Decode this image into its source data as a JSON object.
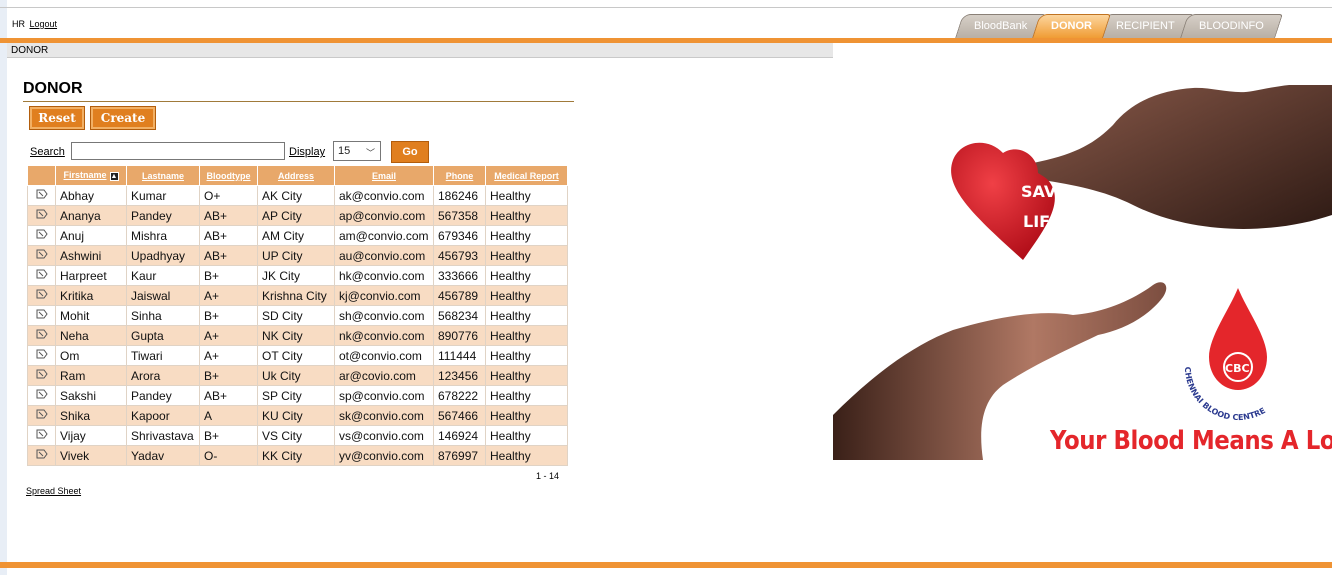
{
  "header": {
    "user_label": "HR",
    "logout_label": "Logout",
    "tabs": [
      {
        "label": "BloodBank",
        "active": false
      },
      {
        "label": "DONOR",
        "active": true
      },
      {
        "label": "RECIPIENT",
        "active": false
      },
      {
        "label": "BLOODINFO",
        "active": false
      }
    ]
  },
  "breadcrumb": "DONOR",
  "page_title": "DONOR",
  "actions": {
    "reset_label": "Reset",
    "create_label": "Create"
  },
  "search": {
    "label": "Search",
    "value": "",
    "display_label": "Display",
    "display_value": "15",
    "go_label": "Go"
  },
  "table": {
    "columns": [
      "Firstname",
      "Lastname",
      "Bloodtype",
      "Address",
      "Email",
      "Phone",
      "Medical Report"
    ],
    "rows": [
      [
        "Abhay",
        "Kumar",
        "O+",
        "AK City",
        "ak@convio.com",
        "186246",
        "Healthy"
      ],
      [
        "Ananya",
        "Pandey",
        "AB+",
        "AP City",
        "ap@convio.com",
        "567358",
        "Healthy"
      ],
      [
        "Anuj",
        "Mishra",
        "AB+",
        "AM City",
        "am@convio.com",
        "679346",
        "Healthy"
      ],
      [
        "Ashwini",
        "Upadhyay",
        "AB+",
        "UP City",
        "au@convio.com",
        "456793",
        "Healthy"
      ],
      [
        "Harpreet",
        "Kaur",
        "B+",
        "JK City",
        "hk@convio.com",
        "333666",
        "Healthy"
      ],
      [
        "Kritika",
        "Jaiswal",
        "A+",
        "Krishna City",
        "kj@convio.com",
        "456789",
        "Healthy"
      ],
      [
        "Mohit",
        "Sinha",
        "B+",
        "SD City",
        "sh@convio.com",
        "568234",
        "Healthy"
      ],
      [
        "Neha",
        "Gupta",
        "A+",
        "NK City",
        "nk@convio.com",
        "890776",
        "Healthy"
      ],
      [
        "Om",
        "Tiwari",
        "A+",
        "OT City",
        "ot@convio.com",
        "111444",
        "Healthy"
      ],
      [
        "Ram",
        "Arora",
        "B+",
        "Uk City",
        "ar@covio.com",
        "123456",
        "Healthy"
      ],
      [
        "Sakshi",
        "Pandey",
        "AB+",
        "SP City",
        "sp@convio.com",
        "678222",
        "Healthy"
      ],
      [
        "Shika",
        "Kapoor",
        "A",
        "KU City",
        "sk@convio.com",
        "567466",
        "Healthy"
      ],
      [
        "Vijay",
        "Shrivastava",
        "B+",
        "VS City",
        "vs@convio.com",
        "146924",
        "Healthy"
      ],
      [
        "Vivek",
        "Yadav",
        "O-",
        "KK City",
        "yv@convio.com",
        "876997",
        "Healthy"
      ]
    ]
  },
  "pager": "1 - 14",
  "spreadsheet_label": "Spread Sheet",
  "banner": {
    "heart_line1": "SAVE",
    "heart_line2": "LIFE",
    "logo_text": "CBC",
    "logo_ring_text": "CHENNAI BLOOD CENTRE",
    "tagline": "Your Blood Means A Lot"
  },
  "colors": {
    "accent": "#ef9334",
    "button": "#e07f1f",
    "row_alt": "#f8dcc3",
    "banner_red": "#e4262b"
  }
}
